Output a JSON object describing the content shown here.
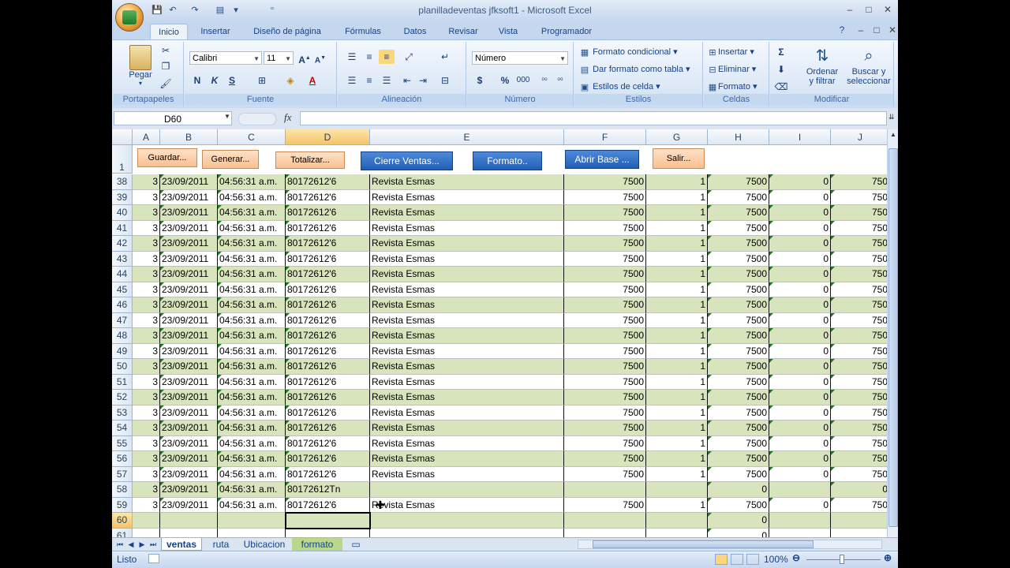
{
  "window": {
    "title": "planilladeventas jfksoft1 - Microsoft Excel",
    "minimize": "–",
    "restore": "□",
    "close": "✕",
    "help": "?",
    "inner_min": "–",
    "inner_restore": "□",
    "inner_close": "✕"
  },
  "tabs": [
    "Inicio",
    "Insertar",
    "Diseño de página",
    "Fórmulas",
    "Datos",
    "Revisar",
    "Vista",
    "Programador"
  ],
  "ribbon": {
    "clipboard": {
      "paste": "Pegar",
      "label": "Portapapeles"
    },
    "font": {
      "name": "Calibri",
      "size": "11",
      "bold": "N",
      "italic": "K",
      "underline": "S",
      "label": "Fuente"
    },
    "alignment": {
      "label": "Alineación"
    },
    "number": {
      "format": "Número",
      "currency": "$",
      "percent": "%",
      "thousands": "000",
      "label": "Número"
    },
    "styles": {
      "conditional": "Formato condicional",
      "as_table": "Dar formato como tabla",
      "cell_styles": "Estilos de celda",
      "label": "Estilos"
    },
    "cells": {
      "insert": "Insertar",
      "delete": "Eliminar",
      "format": "Formato",
      "label": "Celdas"
    },
    "editing": {
      "sort1": "Ordenar",
      "sort2": "y filtrar",
      "find1": "Buscar y",
      "find2": "seleccionar",
      "label": "Modificar"
    }
  },
  "formula_bar": {
    "name_box": "D60",
    "fx": "fx",
    "content": ""
  },
  "columns": [
    "A",
    "B",
    "C",
    "D",
    "E",
    "F",
    "G",
    "H",
    "I",
    "J"
  ],
  "selected_column": "D",
  "buttons": {
    "guardar": "Guardar...",
    "generar": "Generar...",
    "totalizar": "Totalizar...",
    "cierre": "Cierre Ventas...",
    "formato": "Formato..",
    "abrir": "Abrir Base ...",
    "salir": "Salir..."
  },
  "header_row": "1",
  "rows": [
    {
      "n": "38",
      "a": "3",
      "b": "23/09/2011",
      "c": "04:56:31 a.m.",
      "d": "80172612'6",
      "e": "Revista Esmas",
      "f": "7500",
      "g": "1",
      "h": "7500",
      "i": "0",
      "j": "750"
    },
    {
      "n": "39",
      "a": "3",
      "b": "23/09/2011",
      "c": "04:56:31 a.m.",
      "d": "80172612'6",
      "e": "Revista Esmas",
      "f": "7500",
      "g": "1",
      "h": "7500",
      "i": "0",
      "j": "750"
    },
    {
      "n": "40",
      "a": "3",
      "b": "23/09/2011",
      "c": "04:56:31 a.m.",
      "d": "80172612'6",
      "e": "Revista Esmas",
      "f": "7500",
      "g": "1",
      "h": "7500",
      "i": "0",
      "j": "750"
    },
    {
      "n": "41",
      "a": "3",
      "b": "23/09/2011",
      "c": "04:56:31 a.m.",
      "d": "80172612'6",
      "e": "Revista Esmas",
      "f": "7500",
      "g": "1",
      "h": "7500",
      "i": "0",
      "j": "750"
    },
    {
      "n": "42",
      "a": "3",
      "b": "23/09/2011",
      "c": "04:56:31 a.m.",
      "d": "80172612'6",
      "e": "Revista Esmas",
      "f": "7500",
      "g": "1",
      "h": "7500",
      "i": "0",
      "j": "750"
    },
    {
      "n": "43",
      "a": "3",
      "b": "23/09/2011",
      "c": "04:56:31 a.m.",
      "d": "80172612'6",
      "e": "Revista Esmas",
      "f": "7500",
      "g": "1",
      "h": "7500",
      "i": "0",
      "j": "750"
    },
    {
      "n": "44",
      "a": "3",
      "b": "23/09/2011",
      "c": "04:56:31 a.m.",
      "d": "80172612'6",
      "e": "Revista Esmas",
      "f": "7500",
      "g": "1",
      "h": "7500",
      "i": "0",
      "j": "750"
    },
    {
      "n": "45",
      "a": "3",
      "b": "23/09/2011",
      "c": "04:56:31 a.m.",
      "d": "80172612'6",
      "e": "Revista Esmas",
      "f": "7500",
      "g": "1",
      "h": "7500",
      "i": "0",
      "j": "750"
    },
    {
      "n": "46",
      "a": "3",
      "b": "23/09/2011",
      "c": "04:56:31 a.m.",
      "d": "80172612'6",
      "e": "Revista Esmas",
      "f": "7500",
      "g": "1",
      "h": "7500",
      "i": "0",
      "j": "750"
    },
    {
      "n": "47",
      "a": "3",
      "b": "23/09/2011",
      "c": "04:56:31 a.m.",
      "d": "80172612'6",
      "e": "Revista Esmas",
      "f": "7500",
      "g": "1",
      "h": "7500",
      "i": "0",
      "j": "750"
    },
    {
      "n": "48",
      "a": "3",
      "b": "23/09/2011",
      "c": "04:56:31 a.m.",
      "d": "80172612'6",
      "e": "Revista Esmas",
      "f": "7500",
      "g": "1",
      "h": "7500",
      "i": "0",
      "j": "750"
    },
    {
      "n": "49",
      "a": "3",
      "b": "23/09/2011",
      "c": "04:56:31 a.m.",
      "d": "80172612'6",
      "e": "Revista Esmas",
      "f": "7500",
      "g": "1",
      "h": "7500",
      "i": "0",
      "j": "750"
    },
    {
      "n": "50",
      "a": "3",
      "b": "23/09/2011",
      "c": "04:56:31 a.m.",
      "d": "80172612'6",
      "e": "Revista Esmas",
      "f": "7500",
      "g": "1",
      "h": "7500",
      "i": "0",
      "j": "750"
    },
    {
      "n": "51",
      "a": "3",
      "b": "23/09/2011",
      "c": "04:56:31 a.m.",
      "d": "80172612'6",
      "e": "Revista Esmas",
      "f": "7500",
      "g": "1",
      "h": "7500",
      "i": "0",
      "j": "750"
    },
    {
      "n": "52",
      "a": "3",
      "b": "23/09/2011",
      "c": "04:56:31 a.m.",
      "d": "80172612'6",
      "e": "Revista Esmas",
      "f": "7500",
      "g": "1",
      "h": "7500",
      "i": "0",
      "j": "750"
    },
    {
      "n": "53",
      "a": "3",
      "b": "23/09/2011",
      "c": "04:56:31 a.m.",
      "d": "80172612'6",
      "e": "Revista Esmas",
      "f": "7500",
      "g": "1",
      "h": "7500",
      "i": "0",
      "j": "750"
    },
    {
      "n": "54",
      "a": "3",
      "b": "23/09/2011",
      "c": "04:56:31 a.m.",
      "d": "80172612'6",
      "e": "Revista Esmas",
      "f": "7500",
      "g": "1",
      "h": "7500",
      "i": "0",
      "j": "750"
    },
    {
      "n": "55",
      "a": "3",
      "b": "23/09/2011",
      "c": "04:56:31 a.m.",
      "d": "80172612'6",
      "e": "Revista Esmas",
      "f": "7500",
      "g": "1",
      "h": "7500",
      "i": "0",
      "j": "750"
    },
    {
      "n": "56",
      "a": "3",
      "b": "23/09/2011",
      "c": "04:56:31 a.m.",
      "d": "80172612'6",
      "e": "Revista Esmas",
      "f": "7500",
      "g": "1",
      "h": "7500",
      "i": "0",
      "j": "750"
    },
    {
      "n": "57",
      "a": "3",
      "b": "23/09/2011",
      "c": "04:56:31 a.m.",
      "d": "80172612'6",
      "e": "Revista Esmas",
      "f": "7500",
      "g": "1",
      "h": "7500",
      "i": "0",
      "j": "750"
    },
    {
      "n": "58",
      "a": "3",
      "b": "23/09/2011",
      "c": "04:56:31 a.m.",
      "d": "80172612Tn",
      "e": "",
      "f": "",
      "g": "",
      "h": "0",
      "i": "",
      "j": "0"
    },
    {
      "n": "59",
      "a": "3",
      "b": "23/09/2011",
      "c": "04:56:31 a.m.",
      "d": "80172612'6",
      "e": "Revista Esmas",
      "f": "7500",
      "g": "1",
      "h": "7500",
      "i": "0",
      "j": "750"
    },
    {
      "n": "60",
      "a": "",
      "b": "",
      "c": "",
      "d": "",
      "e": "",
      "f": "",
      "g": "",
      "h": "0",
      "i": "",
      "j": ""
    },
    {
      "n": "61",
      "a": "",
      "b": "",
      "c": "",
      "d": "",
      "e": "",
      "f": "",
      "g": "",
      "h": "0",
      "i": "",
      "j": ""
    }
  ],
  "sheets": [
    "ventas",
    "ruta",
    "Ubicacion",
    "formato"
  ],
  "active_sheet": "ventas",
  "status": {
    "ready": "Listo",
    "zoom": "100%"
  }
}
